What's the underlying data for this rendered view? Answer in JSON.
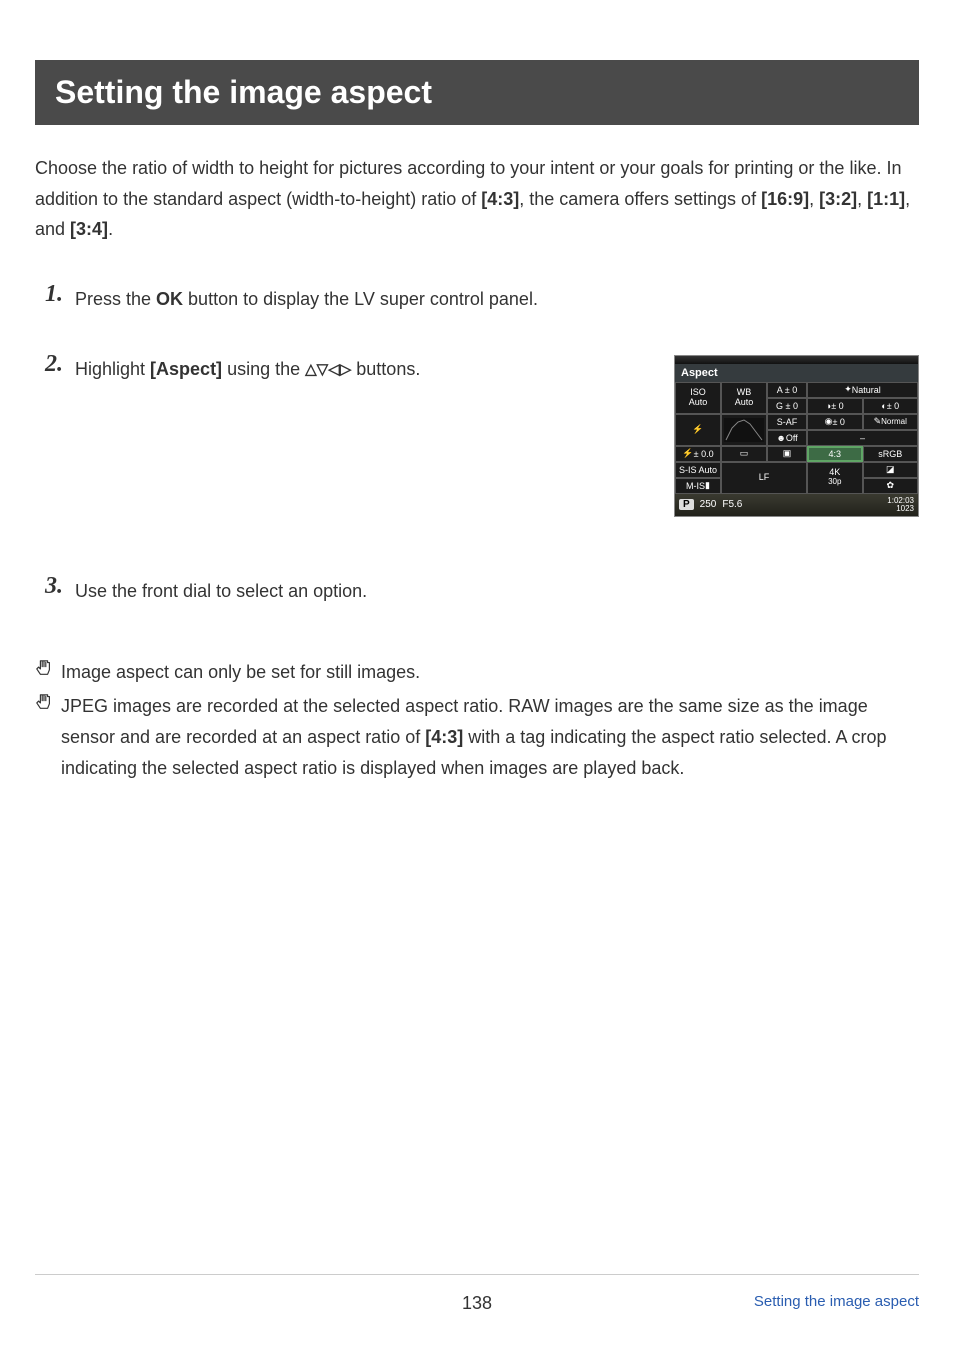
{
  "title": "Setting the image aspect",
  "intro": {
    "pre": "Choose the ratio of width to height for pictures according to your intent or your goals for printing or the like. In addition to the standard aspect (width-to-height) ratio of ",
    "ratio_std": "[4:3]",
    "mid": ", the camera offers settings of ",
    "r1": "[16:9]",
    "c1": ", ",
    "r2": "[3:2]",
    "c2": ", ",
    "r3": "[1:1]",
    "c3": ", and ",
    "r4": "[3:4]",
    "end": "."
  },
  "steps": {
    "s1": {
      "num": "1.",
      "a": "Press the ",
      "b": "OK",
      "c": " button to display the LV super control panel."
    },
    "s2": {
      "num": "2.",
      "a": "Highlight ",
      "b": "[Aspect]",
      "c": " using the ",
      "d": " buttons."
    },
    "s3": {
      "num": "3.",
      "a": "Use the front dial to select an option."
    }
  },
  "panel": {
    "title": "Aspect",
    "iso_label": "ISO",
    "iso_val": "Auto",
    "wb_label": "WB",
    "wb_val": "Auto",
    "a0": "A ± 0",
    "g0": "G ± 0",
    "natural": "Natural",
    "s_pm0": "± 0",
    "d_pm0": "± 0",
    "saf": "S-AF",
    "off": "Off",
    "sc_pm0": "± 0",
    "normal": "Normal",
    "flash_pm": "± 0.0",
    "aspect_val": "4:3",
    "srgb": "sRGB",
    "sis": "S-IS Auto",
    "lf": "LF",
    "rec": "4K",
    "rec2": "30p",
    "mis": "M-IS",
    "p": "P",
    "shutter": "250",
    "fnum": "F5.6",
    "time": "1:02:03",
    "shots": "1023"
  },
  "notes": {
    "n1": "Image aspect can only be set for still images.",
    "n2_a": "JPEG images are recorded at the selected aspect ratio. RAW images are the same size as the image sensor and are recorded at an aspect ratio of ",
    "n2_b": "[4:3]",
    "n2_c": " with a tag indicating the aspect ratio selected. A crop indicating the selected aspect ratio is displayed when images are played back."
  },
  "footer": {
    "page": "138",
    "title": "Setting the image aspect"
  }
}
